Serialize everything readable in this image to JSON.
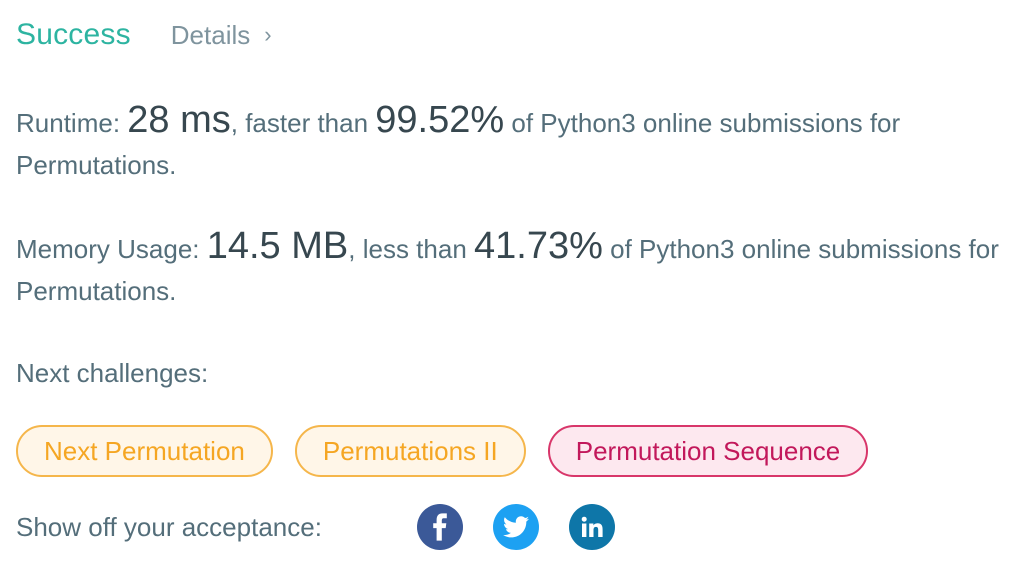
{
  "header": {
    "status": "Success",
    "details_label": "Details",
    "details_chevron": "›"
  },
  "runtime": {
    "label": "Runtime: ",
    "value": "28 ms",
    "mid": ", faster than ",
    "percent": "99.52%",
    "tail": " of Python3 online submissions for Permutations."
  },
  "memory": {
    "label": "Memory Usage: ",
    "value": "14.5 MB",
    "mid": ", less than ",
    "percent": "41.73%",
    "tail": " of Python3 online submissions for Permutations."
  },
  "next": {
    "label": "Next challenges:",
    "challenges": [
      {
        "label": "Next Permutation",
        "difficulty": "medium"
      },
      {
        "label": "Permutations II",
        "difficulty": "medium"
      },
      {
        "label": "Permutation Sequence",
        "difficulty": "hard"
      }
    ]
  },
  "share": {
    "label": "Show off your acceptance:",
    "icons": [
      "facebook-icon",
      "twitter-icon",
      "linkedin-icon"
    ]
  },
  "colors": {
    "success": "#2db4a1",
    "medium": "#f5a623",
    "hard": "#c2185b",
    "facebook": "#3b5998",
    "twitter": "#1da1f2",
    "linkedin": "#0e76a8"
  }
}
